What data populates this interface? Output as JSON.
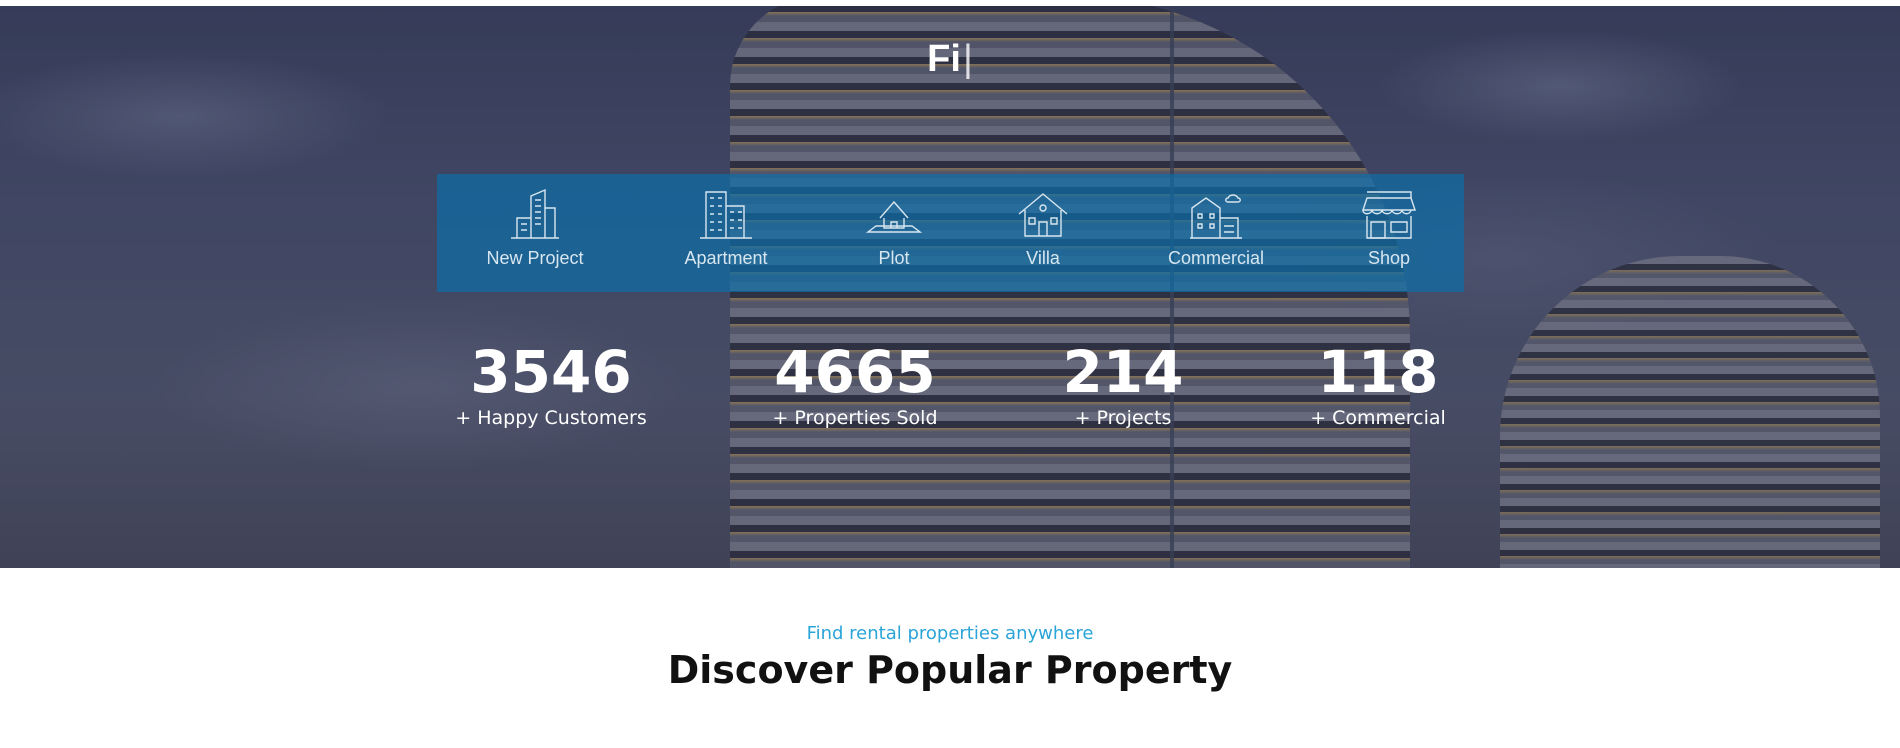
{
  "hero": {
    "typed_title": "Fi",
    "cursor": "|",
    "categories": [
      {
        "label": "New Project",
        "icon": "new-project-building-icon"
      },
      {
        "label": "Apartment",
        "icon": "apartment-building-icon"
      },
      {
        "label": "Plot",
        "icon": "plot-house-icon"
      },
      {
        "label": "Villa",
        "icon": "villa-icon"
      },
      {
        "label": "Commercial",
        "icon": "commercial-building-icon"
      },
      {
        "label": "Shop",
        "icon": "shop-storefront-icon"
      }
    ],
    "stats": [
      {
        "number": "3546",
        "label": "+ Happy Customers"
      },
      {
        "number": "4665",
        "label": "+ Properties Sold"
      },
      {
        "number": "214",
        "label": "+ Projects"
      },
      {
        "number": "118",
        "label": "+ Commercial"
      }
    ]
  },
  "section": {
    "subtitle": "Find rental properties anywhere",
    "title": "Discover Popular Property"
  },
  "colors": {
    "category_bar": "#0a6eaa",
    "accent": "#2ba4d8",
    "heading": "#111111"
  }
}
